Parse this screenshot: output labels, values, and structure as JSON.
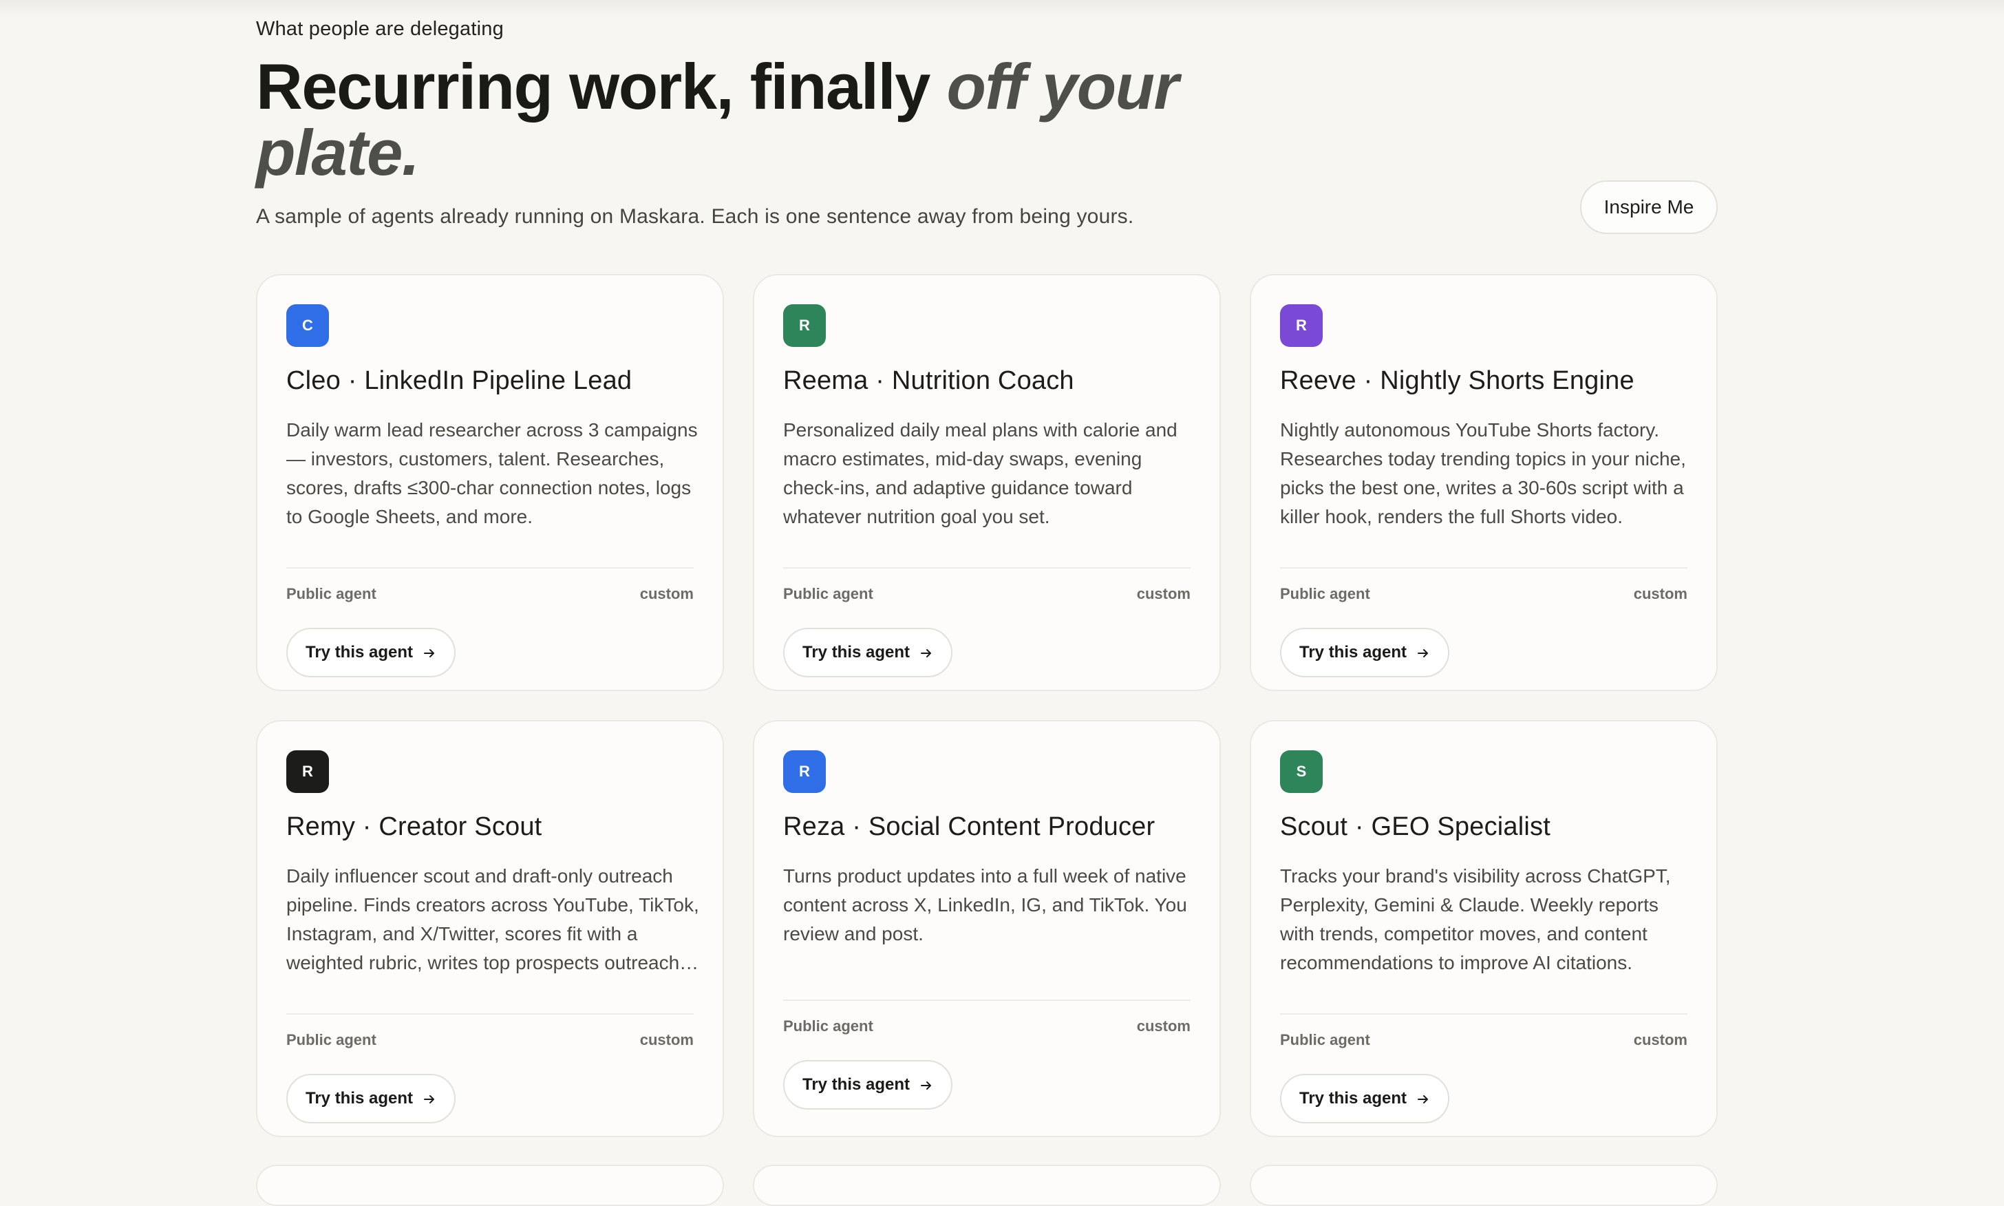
{
  "header": {
    "eyebrow": "What people are delegating",
    "headline_plain": "Recurring work, finally ",
    "headline_italic": "off your plate.",
    "subtitle": "A sample of agents already running on Maskara. Each is one sentence away from being yours.",
    "inspire_label": "Inspire Me"
  },
  "cards": [
    {
      "initial": "C",
      "color": "#2f6ee6",
      "title": "Cleo · LinkedIn Pipeline Lead",
      "desc": "Daily warm lead researcher across 3 campaigns — investors, customers, talent. Researches, scores, drafts ≤300-char connection notes, logs to Google Sheets, and more.",
      "visibility": "Public agent",
      "kind": "custom",
      "cta": "Try this agent"
    },
    {
      "initial": "R",
      "color": "#2e8559",
      "title": "Reema · Nutrition Coach",
      "desc": "Personalized daily meal plans with calorie and macro estimates, mid-day swaps, evening check-ins, and adaptive guidance toward whatever nutrition goal you set.",
      "visibility": "Public agent",
      "kind": "custom",
      "cta": "Try this agent"
    },
    {
      "initial": "R",
      "color": "#7a4ad6",
      "title": "Reeve · Nightly Shorts Engine",
      "desc": "Nightly autonomous YouTube Shorts factory. Researches today trending topics in your niche, picks the best one, writes a 30-60s script with a killer hook, renders the full Shorts video.",
      "visibility": "Public agent",
      "kind": "custom",
      "cta": "Try this agent"
    },
    {
      "initial": "R",
      "color": "#1c1c1a",
      "title": "Remy · Creator Scout",
      "desc": "Daily influencer scout and draft-only outreach pipeline. Finds creators across YouTube, TikTok, Instagram, and X/Twitter, scores fit with a weighted rubric, writes top prospects outreach drafts.",
      "visibility": "Public agent",
      "kind": "custom",
      "cta": "Try this agent"
    },
    {
      "initial": "R",
      "color": "#2f6ee6",
      "title": "Reza · Social Content Producer",
      "desc": "Turns product updates into a full week of native content across X, LinkedIn, IG, and TikTok. You review and post.",
      "visibility": "Public agent",
      "kind": "custom",
      "cta": "Try this agent"
    },
    {
      "initial": "S",
      "color": "#2e8559",
      "title": "Scout · GEO Specialist",
      "desc": "Tracks your brand's visibility across ChatGPT, Perplexity, Gemini & Claude. Weekly reports with trends, competitor moves, and content recommendations to improve AI citations.",
      "visibility": "Public agent",
      "kind": "custom",
      "cta": "Try this agent"
    }
  ],
  "icons": {
    "cta_arrow": "arrow-right-icon"
  }
}
